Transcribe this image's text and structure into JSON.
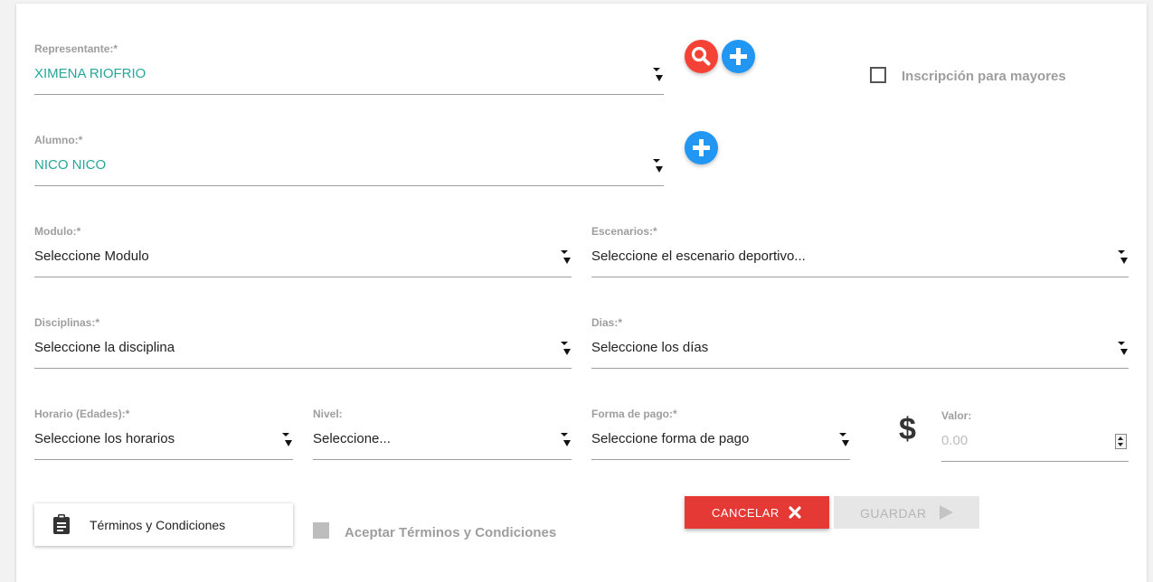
{
  "representante": {
    "label": "Representante:*",
    "value": "XIMENA RIOFRIO"
  },
  "inscripcion_mayores": {
    "label": "Inscripción para mayores",
    "checked": false
  },
  "alumno": {
    "label": "Alumno:*",
    "value": "NICO NICO"
  },
  "modulo": {
    "label": "Modulo:*",
    "value": "Seleccione Modulo"
  },
  "escenarios": {
    "label": "Escenarios:*",
    "value": "Seleccione el escenario deportivo..."
  },
  "disciplinas": {
    "label": "Disciplinas:*",
    "value": "Seleccione la disciplina"
  },
  "dias": {
    "label": "Dias:*",
    "value": "Seleccione los días"
  },
  "horario": {
    "label": "Horario (Edades):*",
    "value": "Seleccione los horarios"
  },
  "nivel": {
    "label": "Nivel:",
    "value": "Seleccione..."
  },
  "forma_pago": {
    "label": "Forma de pago:*",
    "value": "Seleccione forma de pago"
  },
  "valor": {
    "label": "Valor:",
    "placeholder": "0.00",
    "currency_symbol": "$"
  },
  "terminos": {
    "button_label": "Términos y Condiciones",
    "accept_label": "Aceptar Términos y Condiciones",
    "accepted": false
  },
  "actions": {
    "cancel_label": "CANCELAR",
    "save_label": "GUARDAR"
  },
  "colors": {
    "accent_teal": "#26a69a",
    "search_red": "#f44336",
    "add_blue": "#2196f3",
    "cancel_red": "#e53935",
    "disabled_gray": "#e6e6e6"
  },
  "icons": [
    "search-icon",
    "plus-icon",
    "clipboard-icon",
    "close-icon",
    "play-arrow-icon",
    "caret-down-icon"
  ]
}
